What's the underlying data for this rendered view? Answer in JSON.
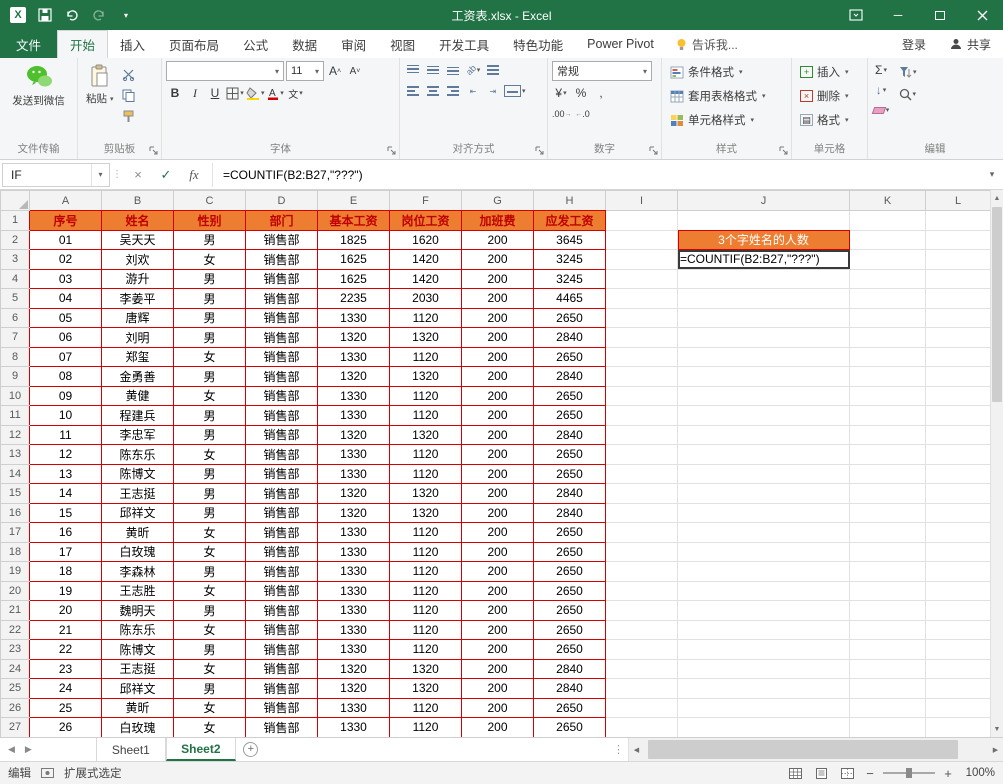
{
  "title_bar": {
    "title": "工资表.xlsx - Excel"
  },
  "ribbon_tabs": {
    "file": "文件",
    "tabs": [
      "开始",
      "插入",
      "页面布局",
      "公式",
      "数据",
      "审阅",
      "视图",
      "开发工具",
      "特色功能",
      "Power Pivot"
    ],
    "active": "开始",
    "tell_me": "告诉我...",
    "sign_in": "登录",
    "share": "共享"
  },
  "ribbon": {
    "groups": {
      "file_transfer": {
        "label": "文件传输",
        "send_wechat": "发送到微信"
      },
      "clipboard": {
        "label": "剪贴板",
        "paste": "粘贴"
      },
      "font": {
        "label": "字体",
        "font_name": "",
        "font_size": "11"
      },
      "alignment": {
        "label": "对齐方式"
      },
      "number": {
        "label": "数字",
        "format": "常规"
      },
      "styles": {
        "label": "样式",
        "conditional": "条件格式",
        "format_as_table": "套用表格格式",
        "cell_styles": "单元格样式"
      },
      "cells": {
        "label": "单元格",
        "insert": "插入",
        "delete": "删除",
        "format": "格式"
      },
      "editing": {
        "label": "编辑"
      }
    }
  },
  "formula_bar": {
    "name_box": "IF",
    "formula": "=COUNTIF(B2:B27,\"???\")"
  },
  "sheet": {
    "columns": [
      "A",
      "B",
      "C",
      "D",
      "E",
      "F",
      "G",
      "H",
      "I",
      "J",
      "K",
      "L"
    ],
    "row_count": 27,
    "header_row": [
      "序号",
      "姓名",
      "性别",
      "部门",
      "基本工资",
      "岗位工资",
      "加班费",
      "应发工资"
    ],
    "rows": [
      [
        "01",
        "吴天天",
        "男",
        "销售部",
        "1825",
        "1620",
        "200",
        "3645"
      ],
      [
        "02",
        "刘欢",
        "女",
        "销售部",
        "1625",
        "1420",
        "200",
        "3245"
      ],
      [
        "03",
        "游升",
        "男",
        "销售部",
        "1625",
        "1420",
        "200",
        "3245"
      ],
      [
        "04",
        "李姜平",
        "男",
        "销售部",
        "2235",
        "2030",
        "200",
        "4465"
      ],
      [
        "05",
        "唐辉",
        "男",
        "销售部",
        "1330",
        "1120",
        "200",
        "2650"
      ],
      [
        "06",
        "刘明",
        "男",
        "销售部",
        "1320",
        "1320",
        "200",
        "2840"
      ],
      [
        "07",
        "郑玺",
        "女",
        "销售部",
        "1330",
        "1120",
        "200",
        "2650"
      ],
      [
        "08",
        "金勇善",
        "男",
        "销售部",
        "1320",
        "1320",
        "200",
        "2840"
      ],
      [
        "09",
        "黄健",
        "女",
        "销售部",
        "1330",
        "1120",
        "200",
        "2650"
      ],
      [
        "10",
        "程建兵",
        "男",
        "销售部",
        "1330",
        "1120",
        "200",
        "2650"
      ],
      [
        "11",
        "李忠军",
        "男",
        "销售部",
        "1320",
        "1320",
        "200",
        "2840"
      ],
      [
        "12",
        "陈东乐",
        "女",
        "销售部",
        "1330",
        "1120",
        "200",
        "2650"
      ],
      [
        "13",
        "陈博文",
        "男",
        "销售部",
        "1330",
        "1120",
        "200",
        "2650"
      ],
      [
        "14",
        "王志挺",
        "男",
        "销售部",
        "1320",
        "1320",
        "200",
        "2840"
      ],
      [
        "15",
        "邱祥文",
        "男",
        "销售部",
        "1320",
        "1320",
        "200",
        "2840"
      ],
      [
        "16",
        "黄昕",
        "女",
        "销售部",
        "1330",
        "1120",
        "200",
        "2650"
      ],
      [
        "17",
        "白玫瑰",
        "女",
        "销售部",
        "1330",
        "1120",
        "200",
        "2650"
      ],
      [
        "18",
        "李森林",
        "男",
        "销售部",
        "1330",
        "1120",
        "200",
        "2650"
      ],
      [
        "19",
        "王志胜",
        "女",
        "销售部",
        "1330",
        "1120",
        "200",
        "2650"
      ],
      [
        "20",
        "魏明天",
        "男",
        "销售部",
        "1330",
        "1120",
        "200",
        "2650"
      ],
      [
        "21",
        "陈东乐",
        "女",
        "销售部",
        "1330",
        "1120",
        "200",
        "2650"
      ],
      [
        "22",
        "陈博文",
        "男",
        "销售部",
        "1330",
        "1120",
        "200",
        "2650"
      ],
      [
        "23",
        "王志挺",
        "女",
        "销售部",
        "1320",
        "1320",
        "200",
        "2840"
      ],
      [
        "24",
        "邱祥文",
        "男",
        "销售部",
        "1320",
        "1320",
        "200",
        "2840"
      ],
      [
        "25",
        "黄昕",
        "女",
        "销售部",
        "1330",
        "1120",
        "200",
        "2650"
      ],
      [
        "26",
        "白玫瑰",
        "女",
        "销售部",
        "1330",
        "1120",
        "200",
        "2650"
      ]
    ],
    "j2_banner": "3个字姓名的人数",
    "j3_formula": "=COUNTIF(B2:B27,\"???\")"
  },
  "sheet_tabs": {
    "tabs": [
      "Sheet1",
      "Sheet2"
    ],
    "active": "Sheet2"
  },
  "status_bar": {
    "mode": "编辑",
    "extend_mode": "扩展式选定",
    "zoom": "100%"
  },
  "colors": {
    "accent_green": "#217346",
    "table_border": "#d40000",
    "header_fill": "#ed7d31",
    "header_text": "#c00000",
    "banner_fill": "#ed7d31",
    "banner_text": "#ffffff"
  },
  "icons": {
    "dropdown": "▾",
    "close": "×",
    "minimize": "─",
    "cancel": "×",
    "enter": "✓",
    "fx": "fx",
    "sigma": "Σ",
    "bold": "B",
    "italic": "I",
    "underline": "U",
    "percent": "%",
    "comma": ",",
    "currency": "¥",
    "scroll_up": "▲",
    "scroll_down": "▼",
    "scroll_left": "◀",
    "scroll_right": "▶",
    "add_sheet": "+",
    "zoom_in": "+",
    "zoom_out": "−",
    "dots": "⋮",
    "phonetic": "文",
    "orientation": "ab",
    "fill_down": "↓",
    "grow_font": "A",
    "shrink_font": "A",
    "inc_decimal": ".00",
    "dec_decimal": ".0"
  }
}
